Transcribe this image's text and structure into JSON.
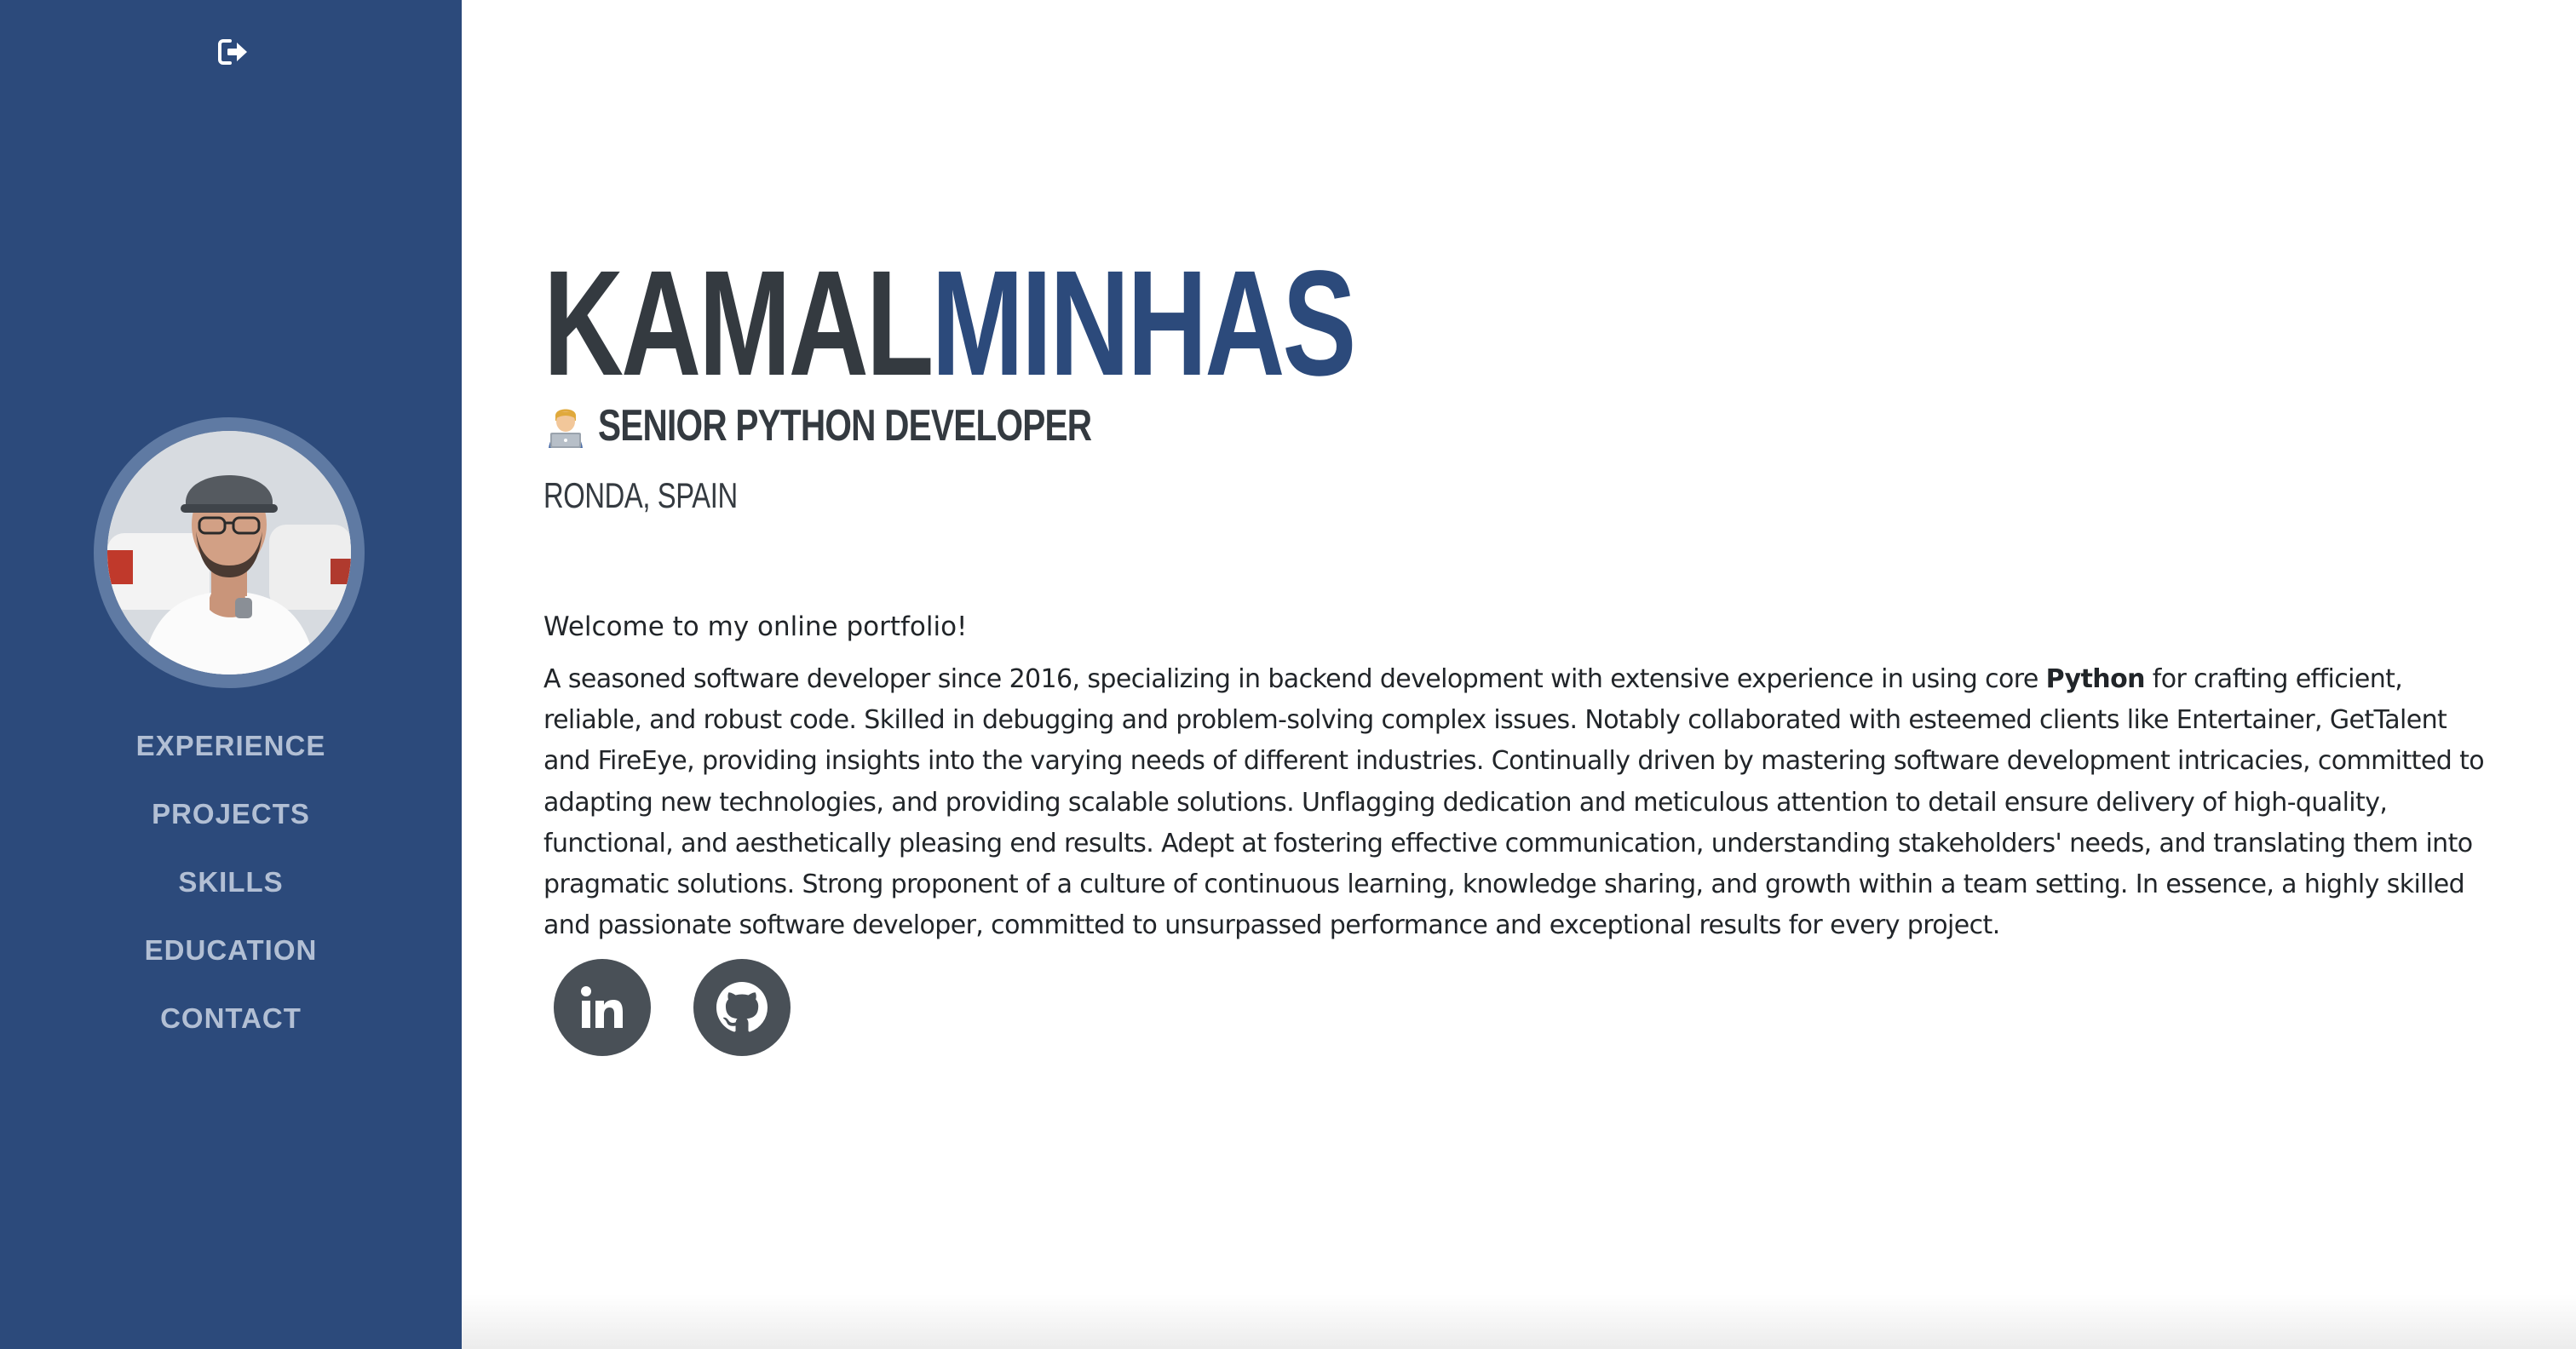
{
  "sidebar": {
    "logout_icon": "sign-out-icon",
    "avatar_alt": "profile-photo",
    "nav": [
      {
        "label": "EXPERIENCE"
      },
      {
        "label": "PROJECTS"
      },
      {
        "label": "SKILLS"
      },
      {
        "label": "EDUCATION"
      },
      {
        "label": "CONTACT"
      }
    ]
  },
  "header": {
    "first_name": "KAMAL",
    "last_name": "MINHAS",
    "role_icon": "technologist-emoji",
    "role": "SENIOR PYTHON DEVELOPER",
    "location": "RONDA, SPAIN"
  },
  "about": {
    "welcome": "Welcome to my online portfolio!",
    "bio_before": "A seasoned software developer since 2016, specializing in backend development with extensive experience in using core ",
    "bio_bold": "Python",
    "bio_after": " for crafting efficient, reliable, and robust code. Skilled in debugging and problem-solving complex issues. Notably collaborated with esteemed clients like Entertainer, GetTalent and FireEye, providing insights into the varying needs of different industries. Continually driven by mastering software development intricacies, committed to adapting new technologies, and providing scalable solutions. Unflagging dedication and meticulous attention to detail ensure delivery of high-quality, functional, and aesthetically pleasing end results. Adept at fostering effective communication, understanding stakeholders' needs, and translating them into pragmatic solutions. Strong proponent of a culture of continuous learning, knowledge sharing, and growth within a team setting. In essence, a highly skilled and passionate software developer, committed to unsurpassed performance and exceptional results for every project."
  },
  "social": [
    {
      "icon": "linkedin-icon"
    },
    {
      "icon": "github-icon"
    }
  ],
  "colors": {
    "sidebar_bg": "#2c4a7b",
    "accent": "#2c4a7b",
    "dark_text": "#343a40",
    "nav_text": "#b2bfd4",
    "social_bg": "#495057"
  }
}
